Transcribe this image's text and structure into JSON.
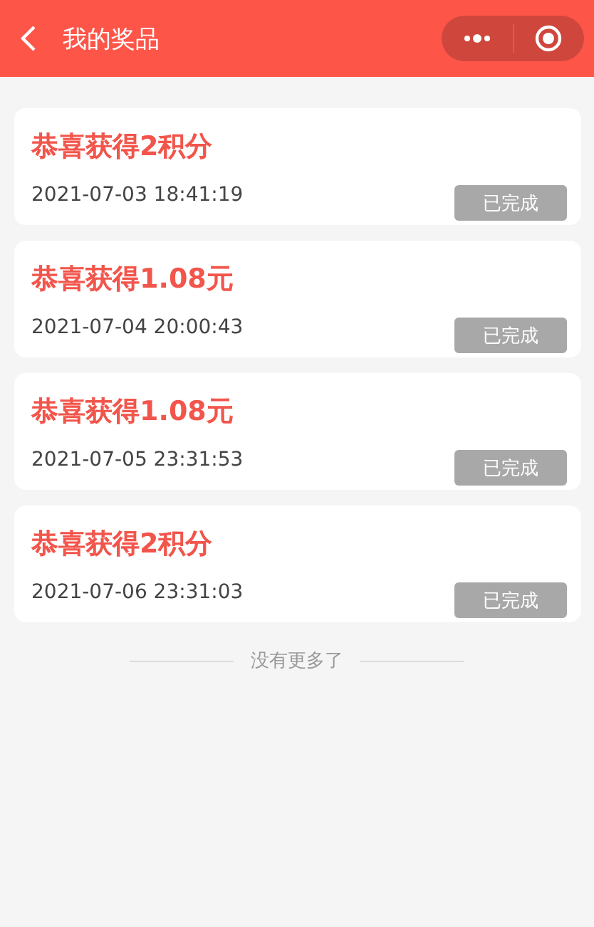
{
  "header": {
    "title": "我的奖品"
  },
  "prizes": [
    {
      "title": "恭喜获得2积分",
      "time": "2021-07-03 18:41:19",
      "status": "已完成"
    },
    {
      "title": "恭喜获得1.08元",
      "time": "2021-07-04 20:00:43",
      "status": "已完成"
    },
    {
      "title": "恭喜获得1.08元",
      "time": "2021-07-05 23:31:53",
      "status": "已完成"
    },
    {
      "title": "恭喜获得2积分",
      "time": "2021-07-06 23:31:03",
      "status": "已完成"
    }
  ],
  "footer": {
    "text": "没有更多了"
  }
}
